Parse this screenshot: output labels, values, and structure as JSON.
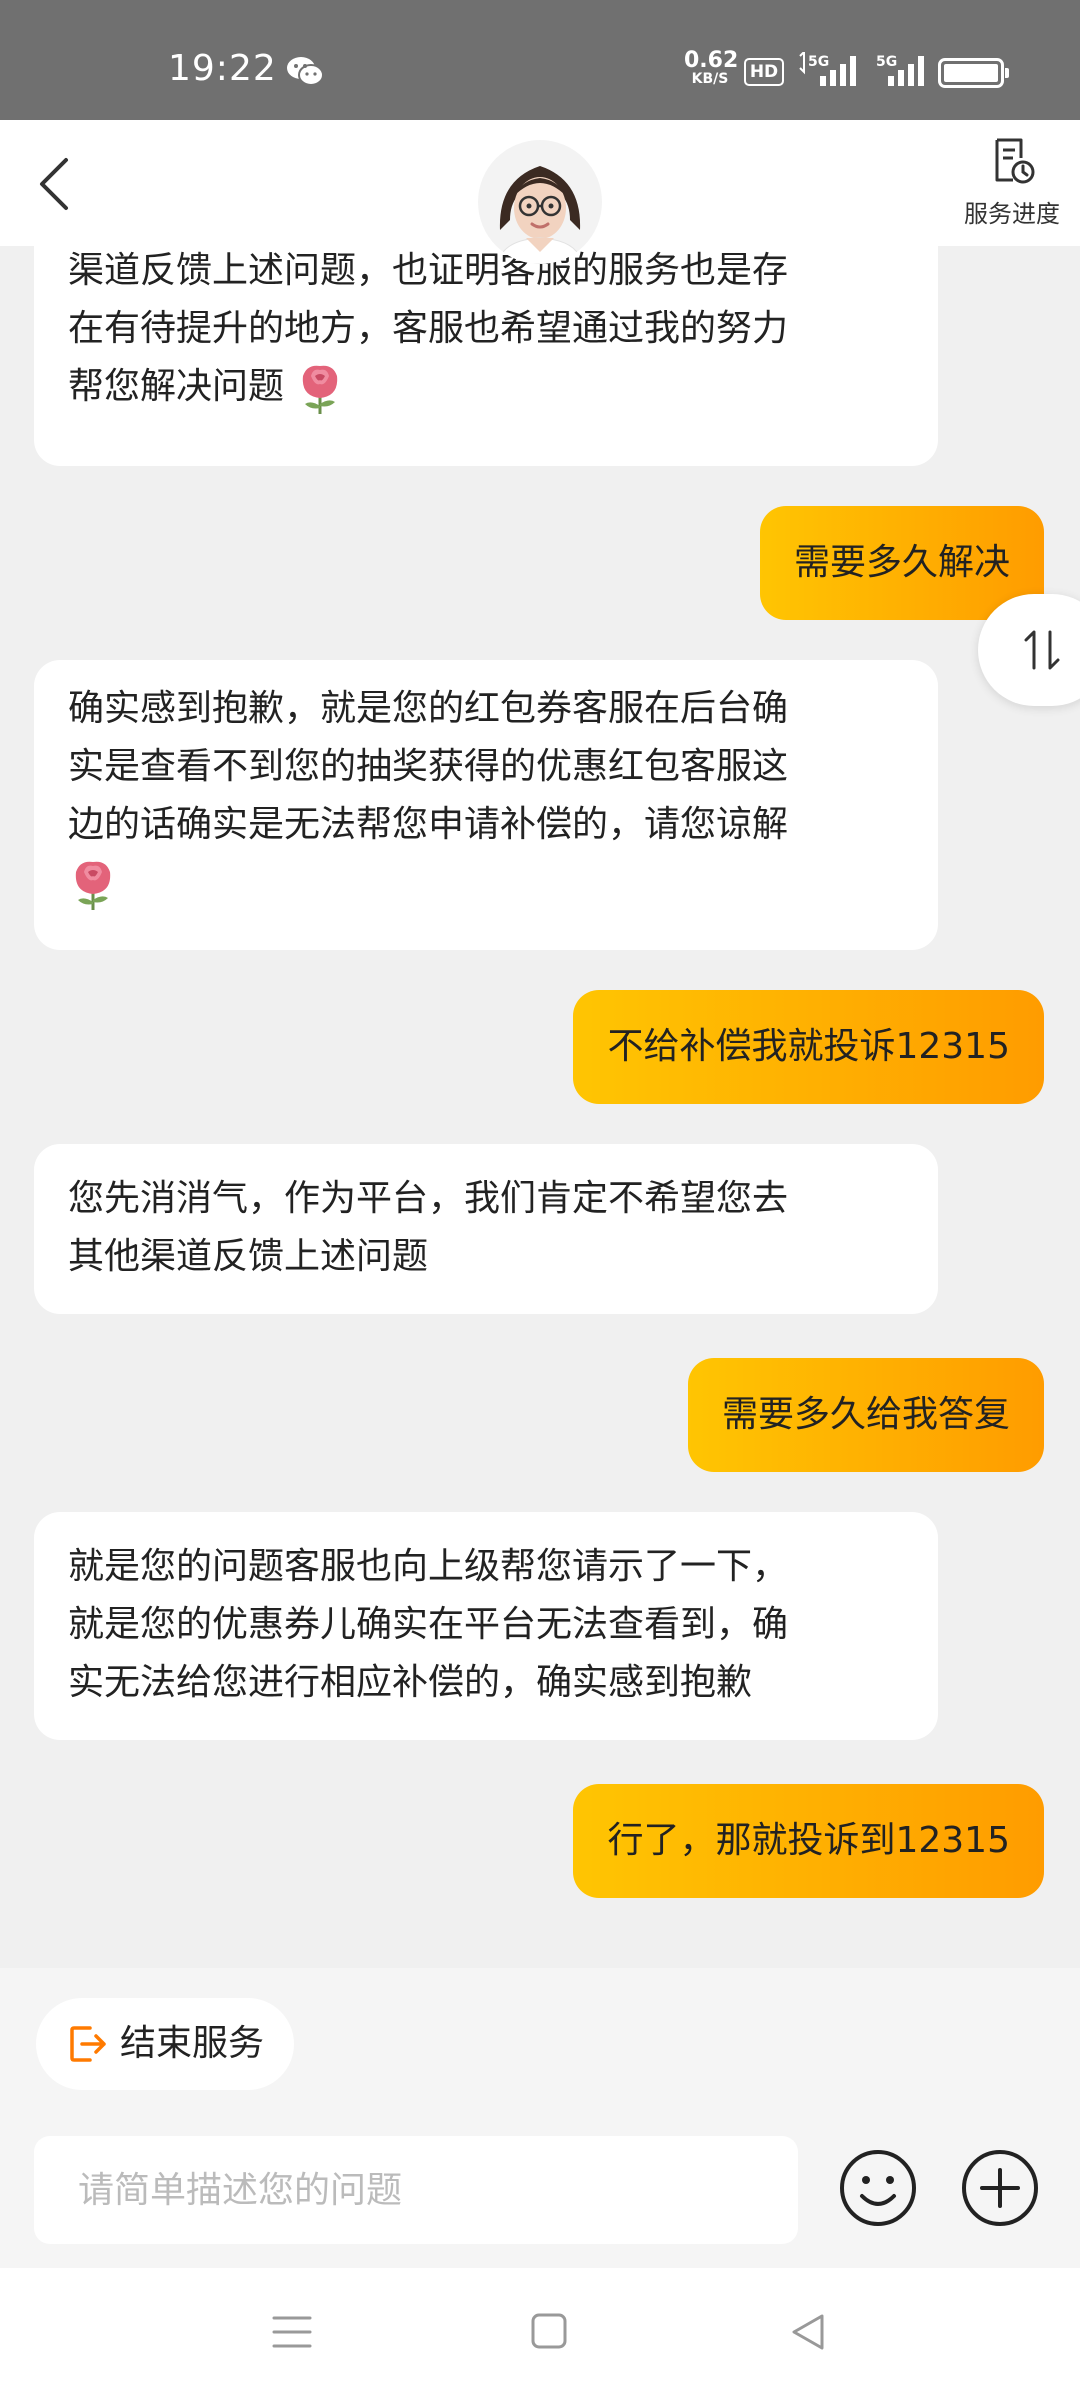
{
  "status_bar": {
    "time": "19:22",
    "net_speed_value": "0.62",
    "net_speed_unit": "KB/S",
    "hd_label": "HD",
    "signal1_label": "5G",
    "signal2_label": "5G",
    "icons": [
      "wechat-icon",
      "signal-icon",
      "battery-icon"
    ]
  },
  "header": {
    "progress_label": "服务进度",
    "icons": [
      "back-icon",
      "agent-avatar",
      "service-progress-icon"
    ]
  },
  "messages": [
    {
      "side": "agent",
      "lines": [
        "渠道反馈上述问题，也证明客服的服务也是存",
        "在有待提升的地方，客服也希望通过我的努力",
        "帮您解决问题"
      ],
      "rose": true
    },
    {
      "side": "user",
      "text": "需要多久解决"
    },
    {
      "side": "agent",
      "lines": [
        "确实感到抱歉，就是您的红包券客服在后台确",
        "实是查看不到您的抽奖获得的优惠红包客服这",
        "边的话确实是无法帮您申请补偿的，请您谅解"
      ],
      "rose": true
    },
    {
      "side": "user",
      "text": "不给补偿我就投诉12315"
    },
    {
      "side": "agent",
      "lines": [
        "您先消消气，作为平台，我们肯定不希望您去",
        "其他渠道反馈上述问题"
      ]
    },
    {
      "side": "user",
      "text": "需要多久给我答复"
    },
    {
      "side": "agent",
      "lines": [
        "就是您的问题客服也向上级帮您请示了一下，",
        "就是您的优惠券儿确实在平台无法查看到，确",
        "实无法给您进行相应补偿的，确实感到抱歉"
      ]
    },
    {
      "side": "user",
      "text": "行了，那就投诉到12315"
    }
  ],
  "bottom": {
    "end_service_label": "结束服务",
    "input_placeholder": "请简单描述您的问题",
    "icons": [
      "exit-icon",
      "emoji-icon",
      "plus-icon"
    ]
  },
  "colors": {
    "user_bubble_start": "#ffc502",
    "user_bubble_end": "#ff9c00",
    "accent_orange": "#ff7a00"
  }
}
